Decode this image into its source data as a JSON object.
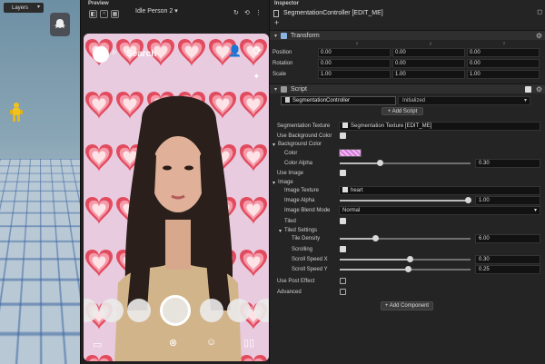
{
  "scene": {
    "layers_label": "Layers",
    "ghost_icon": "snapchat-ghost-icon"
  },
  "preview": {
    "title": "Preview",
    "device": "Idle Person 2",
    "search_label": "Search",
    "top_icons": [
      "add-friend-icon",
      "flip-camera-icon"
    ],
    "bottom_icons": [
      "chat-icon",
      "close-icon",
      "lens-icon",
      "stories-icon"
    ]
  },
  "inspector": {
    "title": "Inspector",
    "object_name": "SegmentationController [EDIT_ME]",
    "transform": {
      "label": "Transform",
      "axes": [
        "x",
        "y",
        "z"
      ],
      "rows": [
        {
          "label": "Position",
          "values": [
            "0.00",
            "0.00",
            "0.00"
          ]
        },
        {
          "label": "Rotation",
          "values": [
            "0.00",
            "0.00",
            "0.00"
          ]
        },
        {
          "label": "Scale",
          "values": [
            "1.00",
            "1.00",
            "1.00"
          ]
        }
      ]
    },
    "script": {
      "label": "Script",
      "name": "SegmentationController",
      "state": "Initialized",
      "add_script_label": "+ Add Script",
      "segmentation_texture_label": "Segmentation Texture",
      "segmentation_texture_value": "Segmentation Texture [EDIT_ME]",
      "use_bg_color_label": "Use Background Color",
      "use_bg_color": true,
      "bg_color_group": "Background Color",
      "color_label": "Color",
      "color_value": "#d27bd6",
      "color_alpha_label": "Color Alpha",
      "color_alpha": "0.30",
      "use_image_label": "Use Image",
      "use_image": true,
      "image_group": "Image",
      "image_texture_label": "Image Texture",
      "image_texture_value": "heart",
      "image_alpha_label": "Image Alpha",
      "image_alpha": "1.00",
      "image_blend_label": "Image Blend Mode",
      "image_blend_value": "Normal",
      "tiled_label": "Tiled",
      "tiled": true,
      "tiled_settings_group": "Tiled Settings",
      "tile_density_label": "Tile Density",
      "tile_density": "6.00",
      "scrolling_label": "Scrolling",
      "scrolling": true,
      "scroll_x_label": "Scroll Speed X",
      "scroll_x": "0.30",
      "scroll_y_label": "Scroll Speed Y",
      "scroll_y": "0.25",
      "post_effect_label": "Use Post Effect",
      "post_effect": false,
      "advanced_label": "Advanced",
      "advanced": false
    },
    "add_component_label": "+ Add Component"
  },
  "colors": {
    "accent": "#7aa7d8",
    "heart": "#e24b5e",
    "bg_pink": "#e9cbe0"
  }
}
